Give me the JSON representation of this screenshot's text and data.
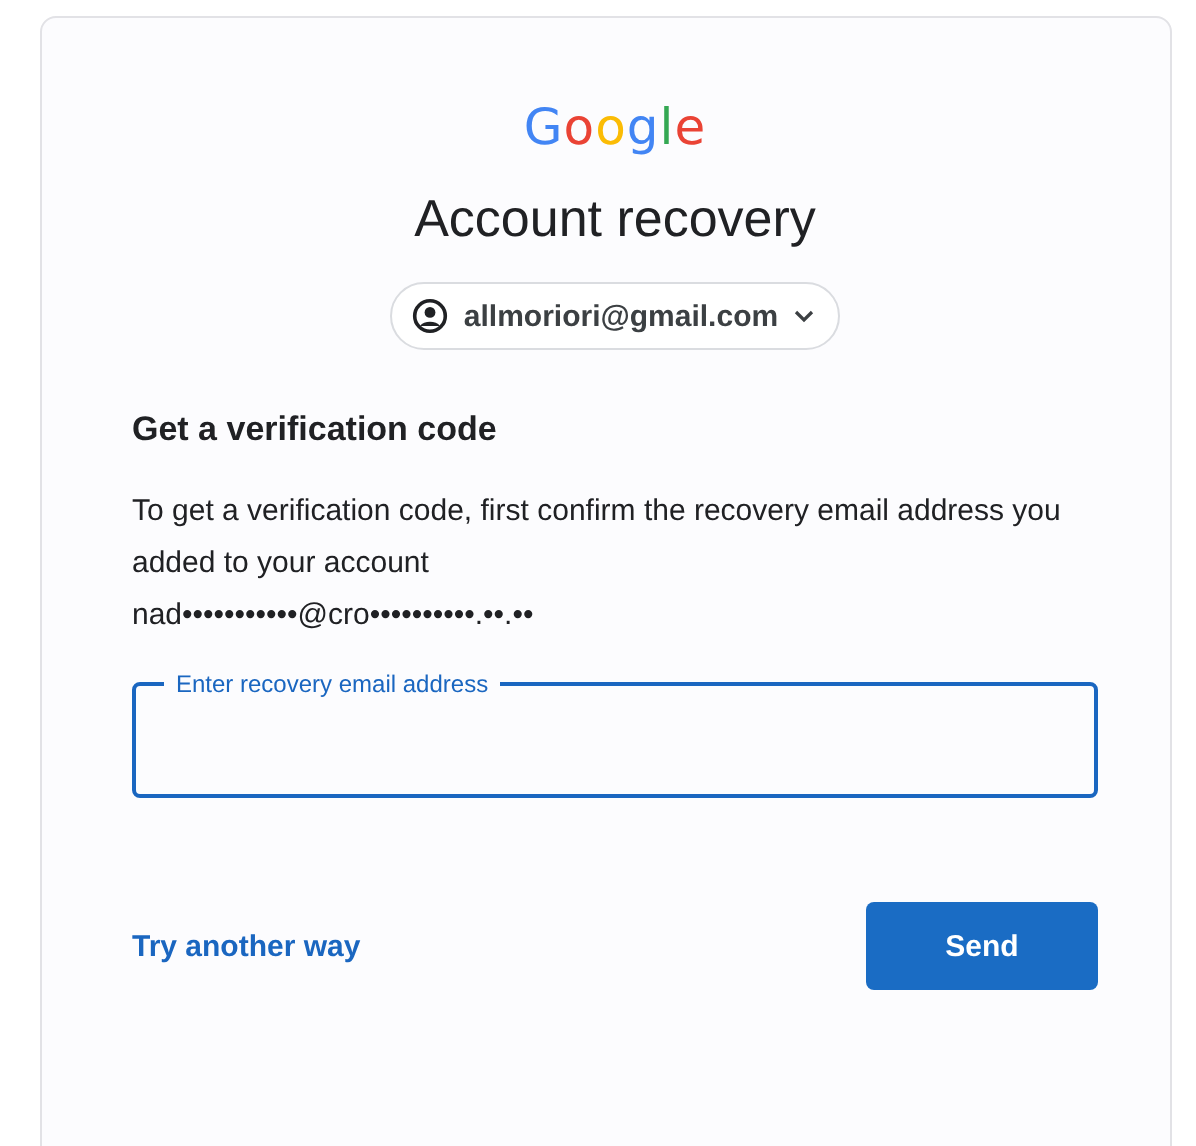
{
  "logo": "Google",
  "title": "Account recovery",
  "account": {
    "email": "allmoriori@gmail.com"
  },
  "heading": "Get a verification code",
  "description": "To get a verification code, first confirm the recovery email address you added to your account",
  "masked_email": "nad•••••••••••@cro••••••••••.••.••",
  "field": {
    "label": "Enter recovery email address",
    "focused": true
  },
  "link": "Try another way",
  "button": "Send"
}
